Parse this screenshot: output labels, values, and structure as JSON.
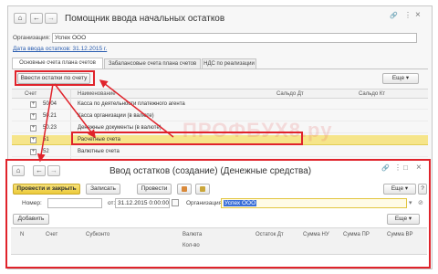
{
  "main": {
    "title": "Помощник ввода начальных остатков",
    "nav": {
      "home": "⌂",
      "back": "←",
      "forward": "→"
    },
    "window_controls": {
      "link": "🔗",
      "more": "⋮",
      "close": "×"
    },
    "org_label": "Организация:",
    "org_value": "Успех ООО",
    "date_link": "Дата ввода остатков: 31.12.2015 г.",
    "tabs": [
      "Основные счета плана счетов",
      "Забалансовые счета плана счетов",
      "НДС по реализации"
    ],
    "enter_button": "Ввести остатки по счету",
    "more_button": "Еще",
    "columns": [
      "Счет",
      "Наименование",
      "Сальдо Дт",
      "Сальдо Кт"
    ],
    "rows": [
      {
        "account": "50.04",
        "name": "Касса по деятельности платежного агента",
        "expander": "+"
      },
      {
        "account": "50.21",
        "name": "Касса организации (в валюте)",
        "expander": "+"
      },
      {
        "account": "50.23",
        "name": "Денежные документы (в валюте)",
        "expander": "+"
      },
      {
        "account": "51",
        "name": "Расчетные счета",
        "expander": "+"
      },
      {
        "account": "52",
        "name": "Валютные счета",
        "expander": "+"
      }
    ]
  },
  "watermark": "ПРОФБУХ8.ру",
  "dialog": {
    "title": "Ввод остатков (создание) (Денежные средства)",
    "nav": {
      "home": "⌂",
      "back": "←",
      "forward": "→"
    },
    "window_controls": {
      "link": "🔗",
      "more": "⋮",
      "maximize": "□",
      "close": "×"
    },
    "post_close_button": "Провести и закрыть",
    "save_button": "Записать",
    "post_button": "Провести",
    "more_button": "Еще",
    "help_button": "?",
    "number_label": "Номер:",
    "number_value": "",
    "from_label": "от:",
    "date_value": "31.12.2015  0:00:00",
    "org_label": "Организация:",
    "org_value": "Успех ООО",
    "add_button": "Добавить",
    "table_more_button": "Еще",
    "columns": {
      "n": "N",
      "account": "Счет",
      "subconto": "Субконто",
      "currency": "Валюта",
      "qty": "Кол-во",
      "balance_dt": "Остаток Дт",
      "sum_nu": "Сумма НУ",
      "sum_pr": "Сумма ПР",
      "sum_vr": "Сумма ВР"
    }
  },
  "colors": {
    "highlight_row": "#f6e58a",
    "accent_yellow": "#f1d449",
    "callout_red": "#e0232b",
    "link_blue": "#2a5db0",
    "selection_blue": "#3a6fd8"
  }
}
